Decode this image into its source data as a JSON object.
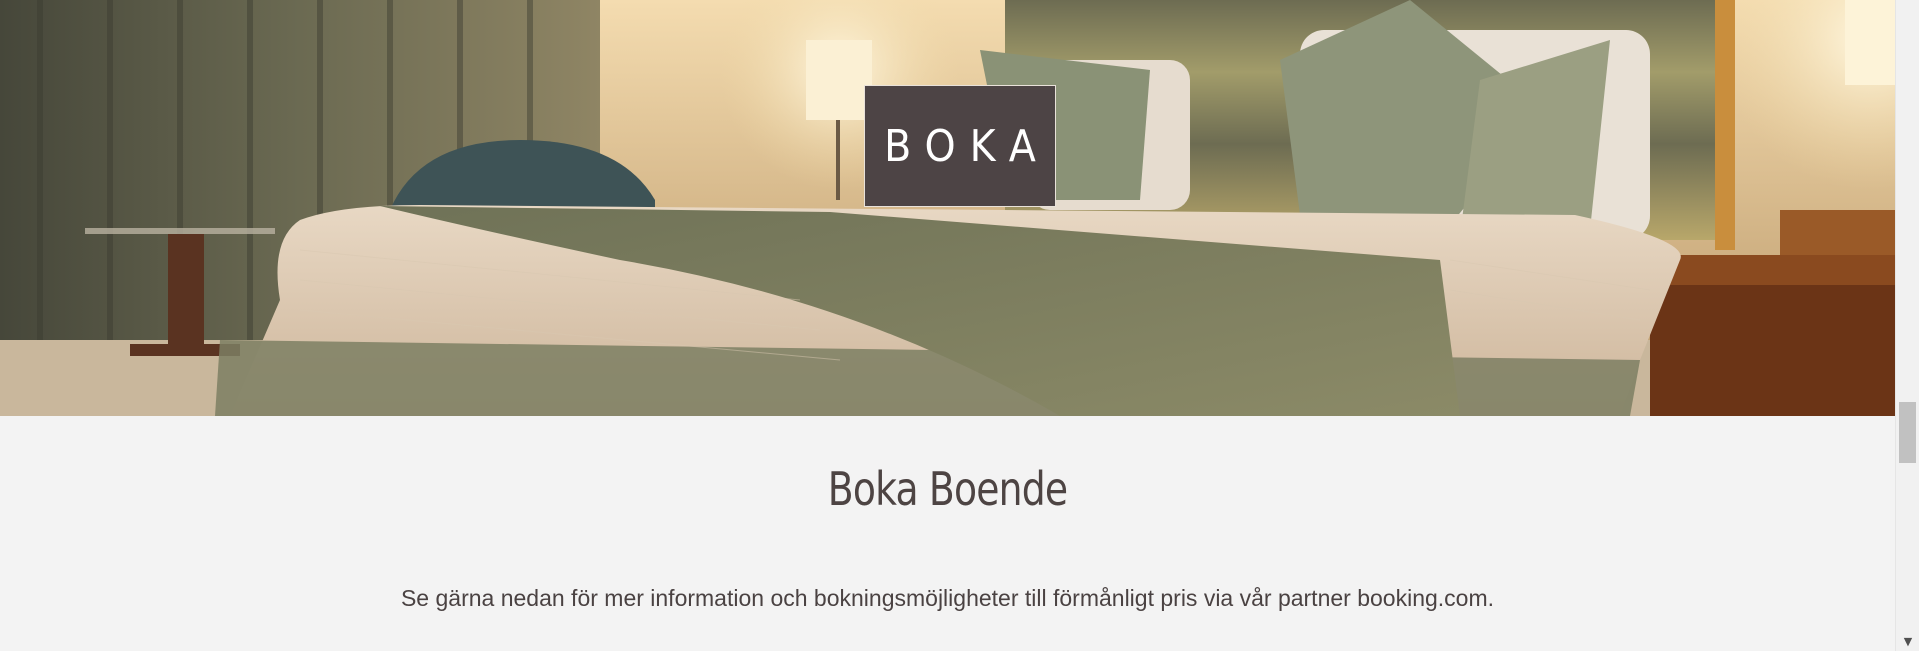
{
  "hero": {
    "badge_label": "BOKA",
    "image_description_icon": "hotel-room-photo"
  },
  "section": {
    "title": "Boka Boende",
    "text": "Se gärna nedan för mer information och bokningsmöjligheter till förmånligt pris via vår partner booking.com."
  },
  "scrollbar": {
    "down_arrow_glyph": "▼"
  },
  "colors": {
    "badge_bg": "#4d4445",
    "title": "#4d4443",
    "body_text": "#4a4242",
    "page_bg": "#f3f3f3"
  }
}
